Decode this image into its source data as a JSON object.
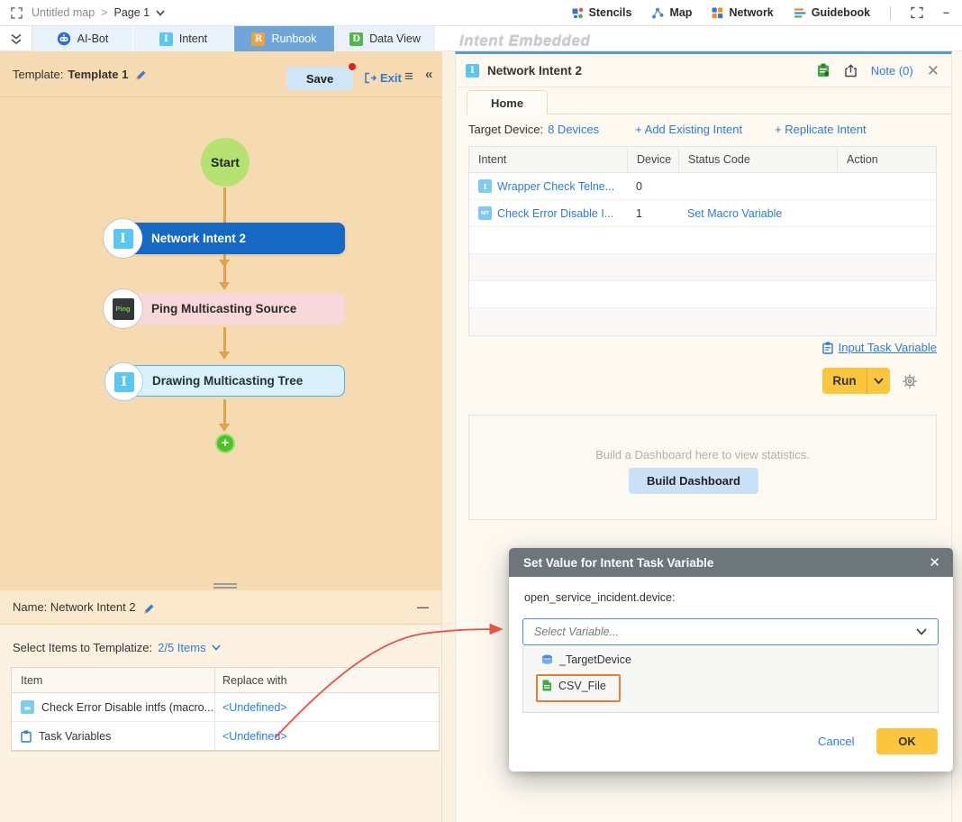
{
  "top_bar": {
    "breadcrumb": {
      "map": "Untitled map",
      "separator": ">",
      "page": "Page 1"
    },
    "menu": [
      {
        "label": "Stencils"
      },
      {
        "label": "Map"
      },
      {
        "label": "Network"
      },
      {
        "label": "Guidebook"
      }
    ]
  },
  "tab_bar": {
    "tabs": [
      {
        "label": "AI-Bot"
      },
      {
        "label": "Intent",
        "icon_letter": "I",
        "icon_color": "#5bc6f2"
      },
      {
        "label": "Runbook",
        "icon_letter": "R",
        "icon_color": "#f0a23c",
        "active": true
      },
      {
        "label": "Data View",
        "icon_letter": "D",
        "icon_color": "#54b54d"
      }
    ],
    "watermark": "Intent Embedded"
  },
  "left_panel": {
    "header": {
      "template_label": "Template:",
      "template_name": "Template 1",
      "save": "Save",
      "exit": "Exit"
    },
    "flowchart": {
      "start": "Start",
      "nodes": [
        {
          "label": "Network Intent 2",
          "icon_letter": "I"
        },
        {
          "label": "Ping Multicasting Source",
          "icon_letter": "Ping"
        },
        {
          "label": "Drawing Multicasting Tree",
          "icon_letter": "I"
        }
      ]
    },
    "name_row": {
      "label": "Name: Network Intent 2",
      "collapse": "—"
    },
    "templatize": {
      "label": "Select Items to Templatize:",
      "value": "2/5 Items"
    },
    "table": {
      "headers": [
        "Item",
        "Replace with"
      ],
      "rows": [
        {
          "item": "Check Error Disable intfs (macro...",
          "replace": "<Undefined>"
        },
        {
          "item": "Task Variables",
          "replace": "<Undefined>"
        }
      ]
    }
  },
  "right_panel": {
    "header": {
      "icon_letter": "I",
      "title": "Network Intent 2",
      "note": "Note (0)",
      "close": "✕"
    },
    "tab": "Home",
    "target": {
      "label": "Target Device:",
      "value": "8 Devices",
      "add": "+ Add Existing Intent",
      "replicate": "+ Replicate Intent"
    },
    "table": {
      "headers": [
        "Intent",
        "Device",
        "Status Code",
        "Action"
      ],
      "rows": [
        {
          "badge": "I",
          "intent": "Wrapper Check Telne...",
          "device": "0",
          "status": "",
          "action": ""
        },
        {
          "badge": "NIT",
          "intent": "Check Error Disable I...",
          "device": "1",
          "status": "Set Macro Variable",
          "action": ""
        }
      ]
    },
    "input_task_variable": "Input Task Variable",
    "run": "Run",
    "dashboard": {
      "hint": "Build a Dashboard here to view statistics.",
      "button": "Build Dashboard"
    }
  },
  "modal": {
    "title": "Set Value for Intent Task Variable",
    "close": "✕",
    "field_label": "open_service_incident.device:",
    "placeholder": "Select Variable...",
    "options": [
      {
        "label": "_TargetDevice"
      },
      {
        "label": "CSV_File",
        "highlighted": true
      }
    ],
    "cancel": "Cancel",
    "ok": "OK"
  },
  "colors": {
    "accent_blue": "#2b7cd3",
    "run_yellow": "#fbc53d",
    "runbook_tab_blue": "#6fa5d8",
    "node_dark_blue": "#1568c4",
    "highlight_orange": "#e87f2f",
    "arrow_red": "#e8504a",
    "canvas_tan": "#f6dbb2"
  }
}
